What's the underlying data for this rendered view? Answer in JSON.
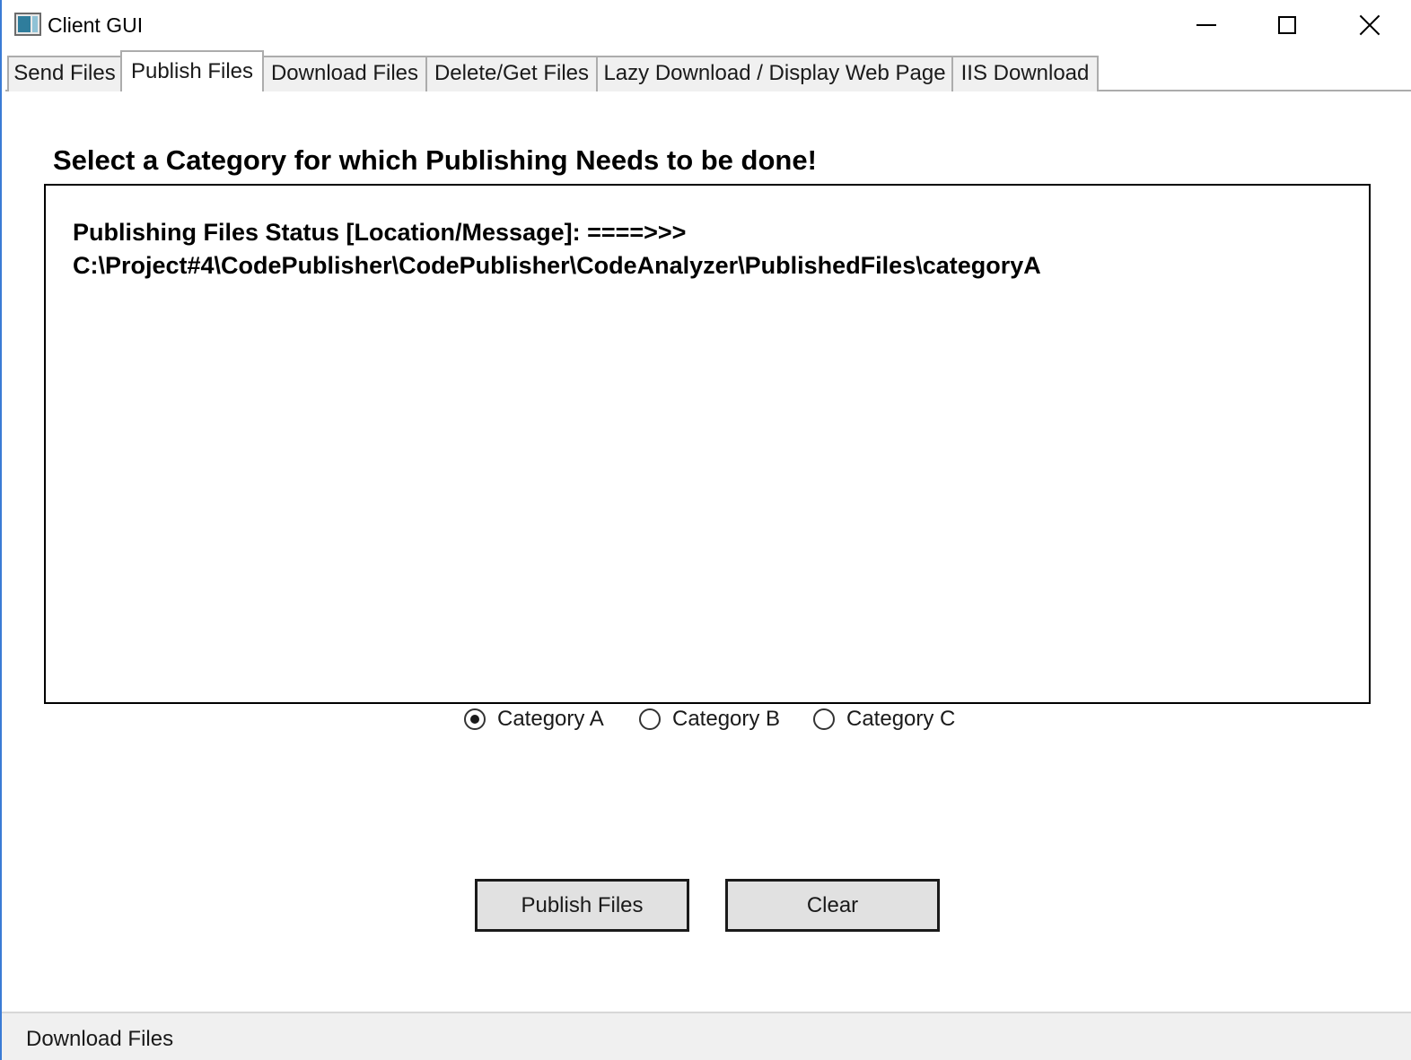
{
  "window": {
    "title": "Client GUI",
    "controls": {
      "minimize": "minimize-icon",
      "maximize": "maximize-icon",
      "close": "close-icon"
    }
  },
  "tabs": [
    {
      "label": "Send Files",
      "active": false
    },
    {
      "label": "Publish Files",
      "active": true
    },
    {
      "label": "Download Files",
      "active": false
    },
    {
      "label": "Delete/Get Files",
      "active": false
    },
    {
      "label": "Lazy Download / Display Web Page",
      "active": false
    },
    {
      "label": "IIS Download",
      "active": false
    }
  ],
  "main": {
    "heading": "Select a Category for which Publishing Needs to be done!",
    "status_lines": [
      "Publishing Files Status [Location/Message]: ====>>>",
      "C:\\Project#4\\CodePublisher\\CodePublisher\\CodeAnalyzer\\PublishedFiles\\categoryA"
    ],
    "categories": [
      {
        "label": "Category A",
        "checked": true
      },
      {
        "label": "Category B",
        "checked": false
      },
      {
        "label": "Category C",
        "checked": false
      }
    ],
    "buttons": {
      "publish": "Publish Files",
      "clear": "Clear"
    }
  },
  "statusbar": {
    "text": "Download Files"
  },
  "colors": {
    "window_border": "#3a7bd5",
    "tab_border": "#acacac",
    "button_face": "#e1e1e1",
    "statusbar_bg": "#f0f0f0"
  }
}
